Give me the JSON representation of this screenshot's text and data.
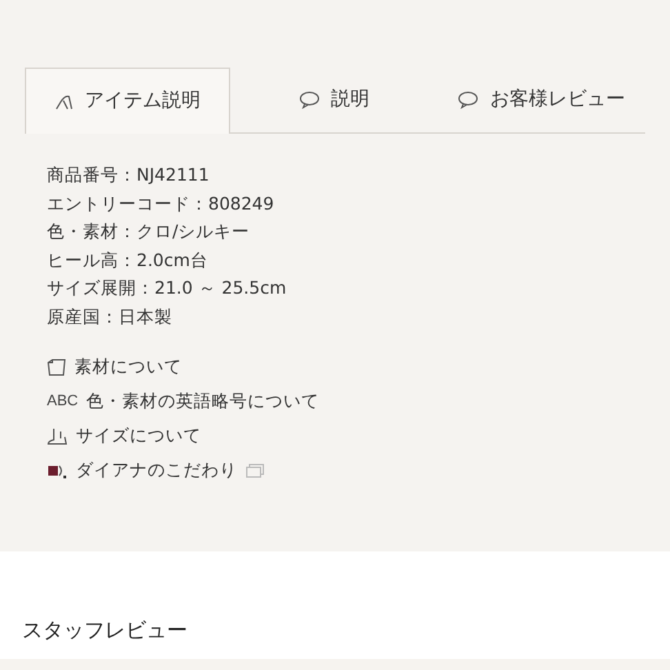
{
  "tabs": [
    {
      "label": "アイテム説明",
      "selected": true
    },
    {
      "label": "説明",
      "selected": false
    },
    {
      "label": "お客様レビュー",
      "selected": false
    }
  ],
  "specs": [
    "商品番号：NJ42111",
    "エントリーコード：808249",
    "色・素材：クロ/シルキー",
    "ヒール高：2.0cm台",
    "サイズ展開：21.0 ～ 25.5cm",
    "原産国：日本製"
  ],
  "links": [
    {
      "kind": "book",
      "label": "素材について",
      "external": false
    },
    {
      "kind": "abc",
      "icon_text": "ABC",
      "label": "色・素材の英語略号について",
      "external": false
    },
    {
      "kind": "foot",
      "label": "サイズについて",
      "external": false
    },
    {
      "kind": "brand",
      "label": "ダイアナのこだわり",
      "external": true
    }
  ],
  "staff_review": {
    "title": "スタッフレビュー"
  }
}
